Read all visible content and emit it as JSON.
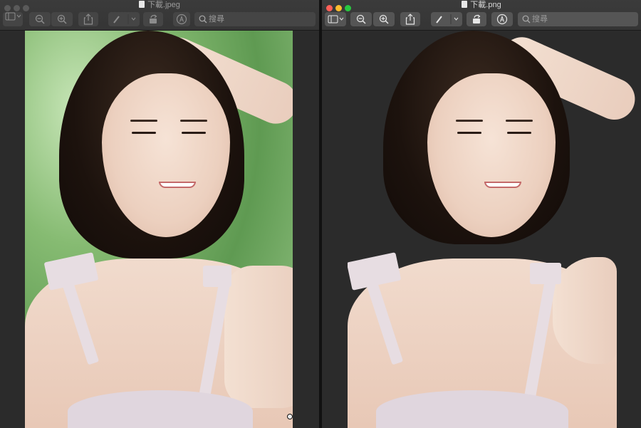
{
  "left_window": {
    "title": "下載.jpeg",
    "search_placeholder": "搜尋",
    "state": "inactive"
  },
  "right_window": {
    "title": "下載.png",
    "search_placeholder": "搜尋",
    "state": "active"
  },
  "toolbar_icons": [
    "sidebar-toggle-icon",
    "zoom-out-icon",
    "zoom-in-icon",
    "share-icon",
    "markup-pen-icon",
    "rotate-icon",
    "markup-toolbar-icon",
    "search-icon"
  ],
  "colors": {
    "window_bg": "#2b2b2b",
    "titlebar": "#3b3b3b",
    "traffic_red": "#fe5f57",
    "traffic_yellow": "#febc2e",
    "traffic_green": "#28c840",
    "photo_background_green": "#7fb06a"
  }
}
